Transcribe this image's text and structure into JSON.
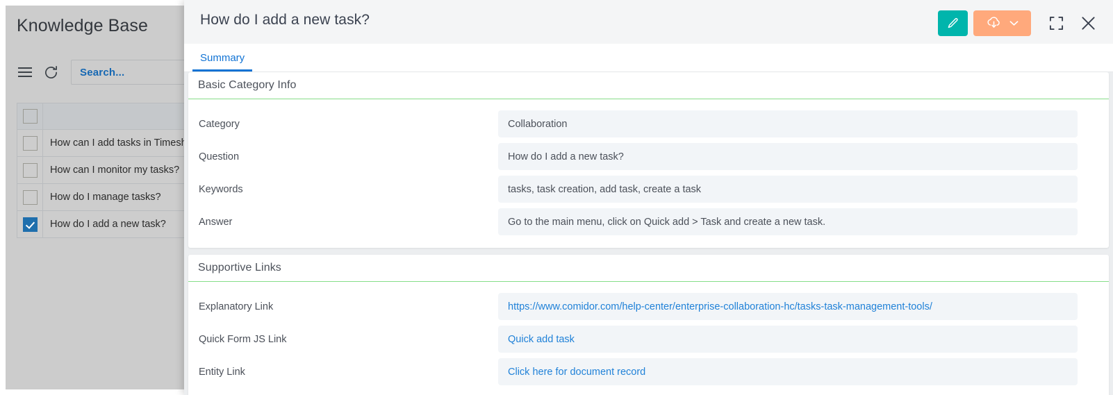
{
  "background_app": {
    "title": "Knowledge Base",
    "toolbar": {
      "menu_icon": "hamburger-menu-icon",
      "refresh_icon": "refresh-icon",
      "search_placeholder": "Search..."
    },
    "list": {
      "header_checkbox_checked": false,
      "items": [
        {
          "label": "How can I add tasks in Timesheet",
          "checked": false
        },
        {
          "label": "How can I monitor my tasks?",
          "checked": false
        },
        {
          "label": "How do I manage tasks?",
          "checked": false
        },
        {
          "label": "How do I add a new task?",
          "checked": true
        }
      ]
    }
  },
  "modal": {
    "title": "How do I add a new task?",
    "actions": {
      "edit_label": "edit-button",
      "edit_icon": "pencil-icon",
      "download_icon": "cloud-download-icon",
      "download_caret_icon": "chevron-down-icon",
      "expand_icon": "fullscreen-expand-icon",
      "close_icon": "close-x-icon"
    },
    "tabs": [
      {
        "label": "Summary",
        "active": true
      }
    ],
    "sections": [
      {
        "title": "Basic Category Info",
        "fields": [
          {
            "label": "Category",
            "value": "Collaboration",
            "is_link": false
          },
          {
            "label": "Question",
            "value": "How do I add a new task?",
            "is_link": false
          },
          {
            "label": "Keywords",
            "value": "tasks, task creation, add task, create a task",
            "is_link": false
          },
          {
            "label": "Answer",
            "value": "Go to the main menu, click on Quick add > Task and create a new task.",
            "is_link": false
          }
        ]
      },
      {
        "title": "Supportive Links",
        "fields": [
          {
            "label": "Explanatory Link",
            "value": "https://www.comidor.com/help-center/enterprise-collaboration-hc/tasks-task-management-tools/",
            "is_link": true
          },
          {
            "label": "Quick Form JS Link",
            "value": "Quick add task",
            "is_link": true
          },
          {
            "label": "Entity Link",
            "value": "Click here for document record",
            "is_link": true
          }
        ]
      }
    ]
  },
  "colors": {
    "accent_blue": "#1173d4",
    "edit_teal": "#00b5ac",
    "download_orange": "#ffa97c",
    "section_underline_green": "#86dd88",
    "link_blue": "#2182d8",
    "checkbox_checked": "#1f6fad"
  }
}
